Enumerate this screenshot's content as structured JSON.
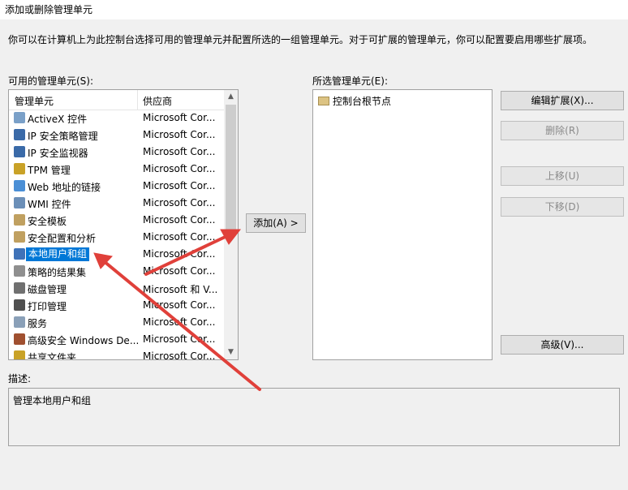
{
  "window": {
    "title": "添加或删除管理单元"
  },
  "intro_text": "你可以在计算机上为此控制台选择可用的管理单元并配置所选的一组管理单元。对于可扩展的管理单元，你可以配置要启用哪些扩展项。",
  "available": {
    "label": "可用的管理单元(S):",
    "col_name": "管理单元",
    "col_vendor": "供应商",
    "items": [
      {
        "name": "ActiveX 控件",
        "vendor": "Microsoft Cor...",
        "icon_color": "#7aa0c8"
      },
      {
        "name": "IP 安全策略管理",
        "vendor": "Microsoft Cor...",
        "icon_color": "#3a6aa8"
      },
      {
        "name": "IP 安全监视器",
        "vendor": "Microsoft Cor...",
        "icon_color": "#3a6aa8"
      },
      {
        "name": "TPM 管理",
        "vendor": "Microsoft Cor...",
        "icon_color": "#c9a227"
      },
      {
        "name": "Web 地址的链接",
        "vendor": "Microsoft Cor...",
        "icon_color": "#4a8fd6"
      },
      {
        "name": "WMI 控件",
        "vendor": "Microsoft Cor...",
        "icon_color": "#6b8fb8"
      },
      {
        "name": "安全模板",
        "vendor": "Microsoft Cor...",
        "icon_color": "#c0a060"
      },
      {
        "name": "安全配置和分析",
        "vendor": "Microsoft Cor...",
        "icon_color": "#c0a060"
      },
      {
        "name": "本地用户和组",
        "vendor": "Microsoft Cor...",
        "icon_color": "#3f72b8",
        "selected": true
      },
      {
        "name": "策略的结果集",
        "vendor": "Microsoft Cor...",
        "icon_color": "#8f8f8f"
      },
      {
        "name": "磁盘管理",
        "vendor": "Microsoft 和 V...",
        "icon_color": "#707070"
      },
      {
        "name": "打印管理",
        "vendor": "Microsoft Cor...",
        "icon_color": "#505050"
      },
      {
        "name": "服务",
        "vendor": "Microsoft Cor...",
        "icon_color": "#8aa0b8"
      },
      {
        "name": "高级安全 Windows De...",
        "vendor": "Microsoft Cor...",
        "icon_color": "#a05030"
      },
      {
        "name": "共享文件夹",
        "vendor": "Microsoft Cor...",
        "icon_color": "#c9a227"
      }
    ]
  },
  "add_button": "添加(A) >",
  "selected": {
    "label": "所选管理单元(E):",
    "root": "控制台根节点"
  },
  "buttons": {
    "edit_ext": "编辑扩展(X)...",
    "remove": "删除(R)",
    "move_up": "上移(U)",
    "move_down": "下移(D)",
    "advanced": "高级(V)..."
  },
  "description": {
    "label": "描述:",
    "text": "管理本地用户和组"
  },
  "colors": {
    "selection": "#0078d7",
    "annotation_arrow": "#e0403a"
  }
}
